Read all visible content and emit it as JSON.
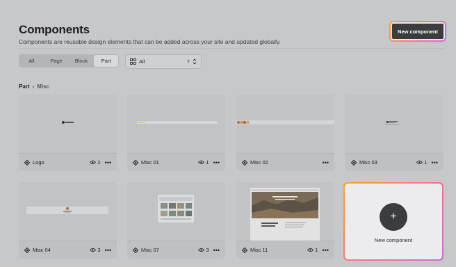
{
  "page": {
    "title": "Components",
    "subtitle": "Components are reusable design elements that can be added across your site and updated globally."
  },
  "header": {
    "new_component_label": "New component"
  },
  "tabs": [
    {
      "label": "All"
    },
    {
      "label": "Page"
    },
    {
      "label": "Block"
    },
    {
      "label": "Part",
      "active": true
    }
  ],
  "filter": {
    "label": "All",
    "count": "7",
    "icon": "grid-icon"
  },
  "breadcrumb": {
    "parent": "Part",
    "separator": "›",
    "current": "Misc"
  },
  "cards": [
    {
      "name": "Logo",
      "views": "2"
    },
    {
      "name": "Misc 01",
      "views": "1"
    },
    {
      "name": "Misc 02",
      "views": ""
    },
    {
      "name": "Misc 03",
      "views": "1"
    },
    {
      "name": "Misc 04",
      "views": "3"
    },
    {
      "name": "Misc 07",
      "views": "3"
    },
    {
      "name": "Misc 11",
      "views": "1"
    }
  ],
  "new_card": {
    "label": "New component",
    "plus": "+"
  },
  "more_glyph": "•••",
  "colors": {
    "accent_gradient_start": "#f5a623",
    "accent_gradient_mid": "#ff6f91",
    "accent_gradient_end": "#c86dd7",
    "dark_button": "#3b3c3e"
  }
}
